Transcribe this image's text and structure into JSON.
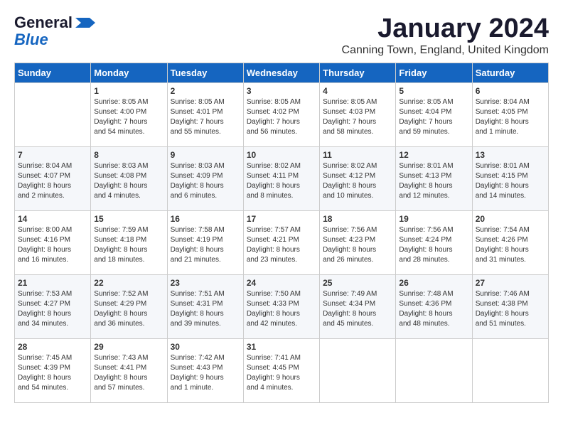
{
  "header": {
    "logo_line1": "General",
    "logo_line2": "Blue",
    "month_title": "January 2024",
    "location": "Canning Town, England, United Kingdom"
  },
  "days_of_week": [
    "Sunday",
    "Monday",
    "Tuesday",
    "Wednesday",
    "Thursday",
    "Friday",
    "Saturday"
  ],
  "weeks": [
    [
      {
        "day": "",
        "content": ""
      },
      {
        "day": "1",
        "content": "Sunrise: 8:05 AM\nSunset: 4:00 PM\nDaylight: 7 hours\nand 54 minutes."
      },
      {
        "day": "2",
        "content": "Sunrise: 8:05 AM\nSunset: 4:01 PM\nDaylight: 7 hours\nand 55 minutes."
      },
      {
        "day": "3",
        "content": "Sunrise: 8:05 AM\nSunset: 4:02 PM\nDaylight: 7 hours\nand 56 minutes."
      },
      {
        "day": "4",
        "content": "Sunrise: 8:05 AM\nSunset: 4:03 PM\nDaylight: 7 hours\nand 58 minutes."
      },
      {
        "day": "5",
        "content": "Sunrise: 8:05 AM\nSunset: 4:04 PM\nDaylight: 7 hours\nand 59 minutes."
      },
      {
        "day": "6",
        "content": "Sunrise: 8:04 AM\nSunset: 4:05 PM\nDaylight: 8 hours\nand 1 minute."
      }
    ],
    [
      {
        "day": "7",
        "content": "Sunrise: 8:04 AM\nSunset: 4:07 PM\nDaylight: 8 hours\nand 2 minutes."
      },
      {
        "day": "8",
        "content": "Sunrise: 8:03 AM\nSunset: 4:08 PM\nDaylight: 8 hours\nand 4 minutes."
      },
      {
        "day": "9",
        "content": "Sunrise: 8:03 AM\nSunset: 4:09 PM\nDaylight: 8 hours\nand 6 minutes."
      },
      {
        "day": "10",
        "content": "Sunrise: 8:02 AM\nSunset: 4:11 PM\nDaylight: 8 hours\nand 8 minutes."
      },
      {
        "day": "11",
        "content": "Sunrise: 8:02 AM\nSunset: 4:12 PM\nDaylight: 8 hours\nand 10 minutes."
      },
      {
        "day": "12",
        "content": "Sunrise: 8:01 AM\nSunset: 4:13 PM\nDaylight: 8 hours\nand 12 minutes."
      },
      {
        "day": "13",
        "content": "Sunrise: 8:01 AM\nSunset: 4:15 PM\nDaylight: 8 hours\nand 14 minutes."
      }
    ],
    [
      {
        "day": "14",
        "content": "Sunrise: 8:00 AM\nSunset: 4:16 PM\nDaylight: 8 hours\nand 16 minutes."
      },
      {
        "day": "15",
        "content": "Sunrise: 7:59 AM\nSunset: 4:18 PM\nDaylight: 8 hours\nand 18 minutes."
      },
      {
        "day": "16",
        "content": "Sunrise: 7:58 AM\nSunset: 4:19 PM\nDaylight: 8 hours\nand 21 minutes."
      },
      {
        "day": "17",
        "content": "Sunrise: 7:57 AM\nSunset: 4:21 PM\nDaylight: 8 hours\nand 23 minutes."
      },
      {
        "day": "18",
        "content": "Sunrise: 7:56 AM\nSunset: 4:23 PM\nDaylight: 8 hours\nand 26 minutes."
      },
      {
        "day": "19",
        "content": "Sunrise: 7:56 AM\nSunset: 4:24 PM\nDaylight: 8 hours\nand 28 minutes."
      },
      {
        "day": "20",
        "content": "Sunrise: 7:54 AM\nSunset: 4:26 PM\nDaylight: 8 hours\nand 31 minutes."
      }
    ],
    [
      {
        "day": "21",
        "content": "Sunrise: 7:53 AM\nSunset: 4:27 PM\nDaylight: 8 hours\nand 34 minutes."
      },
      {
        "day": "22",
        "content": "Sunrise: 7:52 AM\nSunset: 4:29 PM\nDaylight: 8 hours\nand 36 minutes."
      },
      {
        "day": "23",
        "content": "Sunrise: 7:51 AM\nSunset: 4:31 PM\nDaylight: 8 hours\nand 39 minutes."
      },
      {
        "day": "24",
        "content": "Sunrise: 7:50 AM\nSunset: 4:33 PM\nDaylight: 8 hours\nand 42 minutes."
      },
      {
        "day": "25",
        "content": "Sunrise: 7:49 AM\nSunset: 4:34 PM\nDaylight: 8 hours\nand 45 minutes."
      },
      {
        "day": "26",
        "content": "Sunrise: 7:48 AM\nSunset: 4:36 PM\nDaylight: 8 hours\nand 48 minutes."
      },
      {
        "day": "27",
        "content": "Sunrise: 7:46 AM\nSunset: 4:38 PM\nDaylight: 8 hours\nand 51 minutes."
      }
    ],
    [
      {
        "day": "28",
        "content": "Sunrise: 7:45 AM\nSunset: 4:39 PM\nDaylight: 8 hours\nand 54 minutes."
      },
      {
        "day": "29",
        "content": "Sunrise: 7:43 AM\nSunset: 4:41 PM\nDaylight: 8 hours\nand 57 minutes."
      },
      {
        "day": "30",
        "content": "Sunrise: 7:42 AM\nSunset: 4:43 PM\nDaylight: 9 hours\nand 1 minute."
      },
      {
        "day": "31",
        "content": "Sunrise: 7:41 AM\nSunset: 4:45 PM\nDaylight: 9 hours\nand 4 minutes."
      },
      {
        "day": "",
        "content": ""
      },
      {
        "day": "",
        "content": ""
      },
      {
        "day": "",
        "content": ""
      }
    ]
  ]
}
